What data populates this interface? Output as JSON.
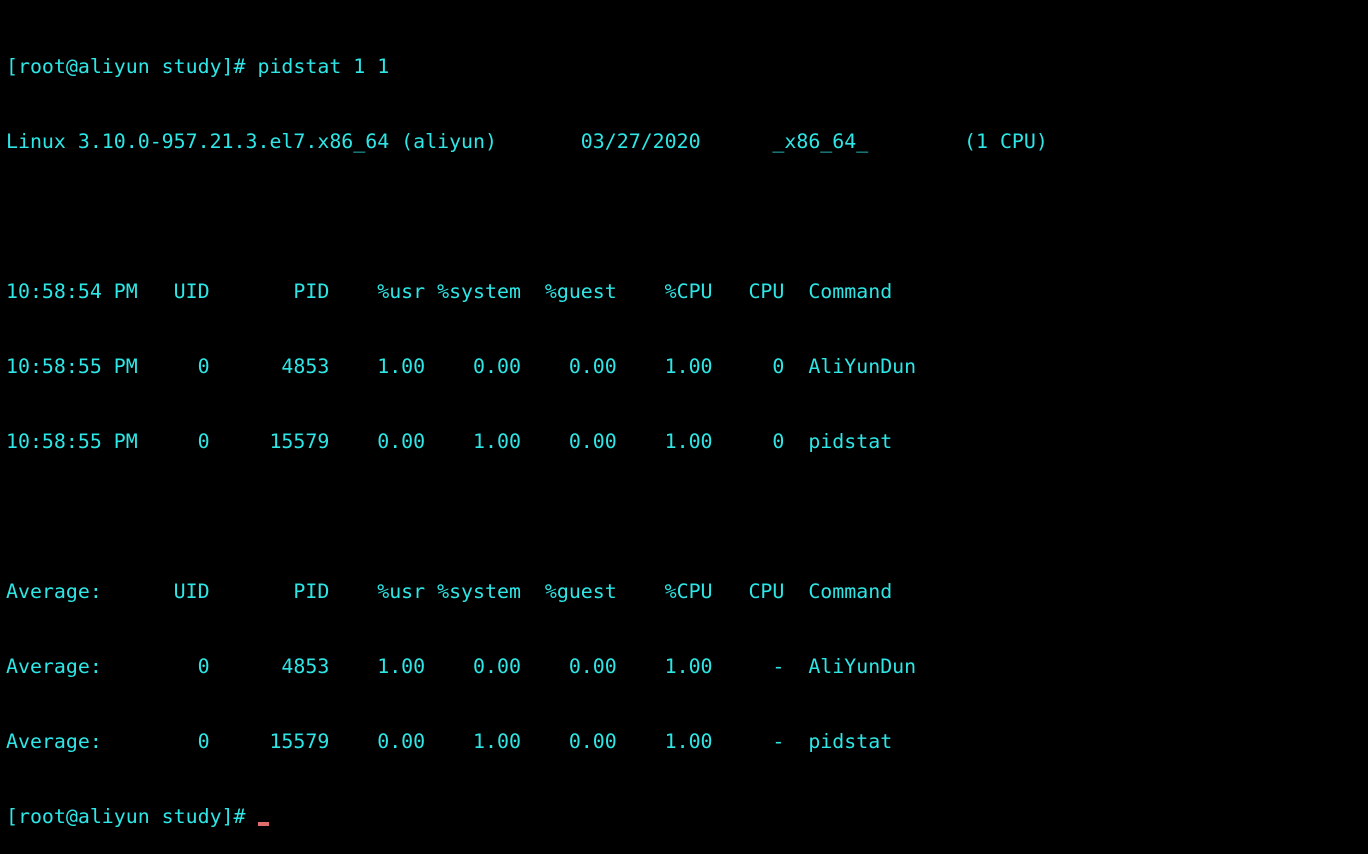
{
  "terminal": {
    "colors": {
      "background": "#000000",
      "foreground": "#2ee6e6",
      "cursor": "#e06c6c"
    },
    "lines": [
      "[root@aliyun study]# pidstat 1 1",
      "Linux 3.10.0-957.21.3.el7.x86_64 (aliyun)       03/27/2020      _x86_64_        (1 CPU)",
      "",
      "10:58:54 PM   UID       PID    %usr %system  %guest    %CPU   CPU  Command",
      "10:58:55 PM     0      4853    1.00    0.00    0.00    1.00     0  AliYunDun",
      "10:58:55 PM     0     15579    0.00    1.00    0.00    1.00     0  pidstat",
      "",
      "Average:      UID       PID    %usr %system  %guest    %CPU   CPU  Command",
      "Average:        0      4853    1.00    0.00    0.00    1.00     -  AliYunDun",
      "Average:        0     15579    0.00    1.00    0.00    1.00     -  pidstat"
    ],
    "prompt": "[root@aliyun study]# "
  }
}
